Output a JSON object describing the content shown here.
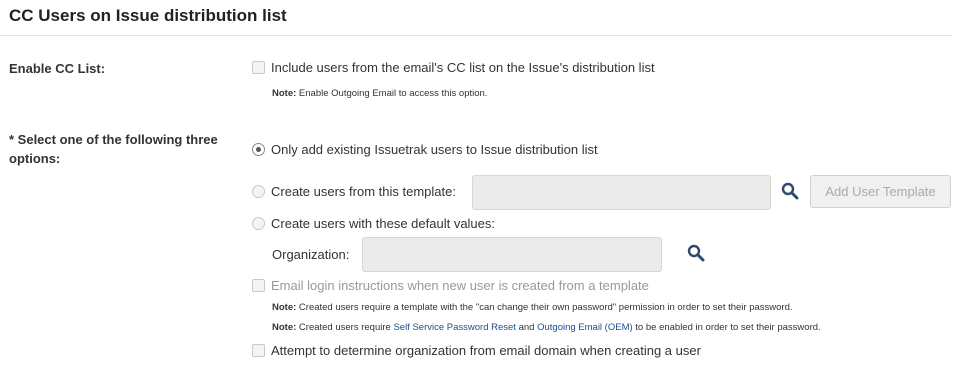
{
  "title": "CC Users on Issue distribution list",
  "enable_cc": {
    "label": "Enable CC List:",
    "checkbox_label": "Include users from the email's CC list on the Issue's distribution list",
    "checked": false,
    "note_prefix": "Note:",
    "note_text": "Enable Outgoing Email to access this option."
  },
  "options": {
    "label_line1": "* Select one of the following three",
    "label_line2": "options:",
    "radio1": "Only add existing Issuetrak users to Issue distribution list",
    "radio2": "Create users from this template:",
    "radio3": "Create users with these default values:",
    "selected": "radio1"
  },
  "template": {
    "value": "",
    "add_button": "Add User Template"
  },
  "organization": {
    "label": "Organization:",
    "value": ""
  },
  "email_login": {
    "label": "Email login instructions when new user is created from a template",
    "checked": false,
    "note1_prefix": "Note:",
    "note1_text": "Created users require a template with the \"can change their own password\" permission in order to set their password.",
    "note2_prefix": "Note:",
    "note2_before": "Created users require",
    "note2_link1": "Self Service Password Reset",
    "note2_and": "and",
    "note2_link2": "Outgoing Email (OEM)",
    "note2_after": "to be enabled in order to set their password."
  },
  "determine_org": {
    "label": "Attempt to determine organization from email domain when creating a user",
    "checked": false
  },
  "colors": {
    "link": "#1e4f8a",
    "search_icon": "#2b4a6f"
  }
}
